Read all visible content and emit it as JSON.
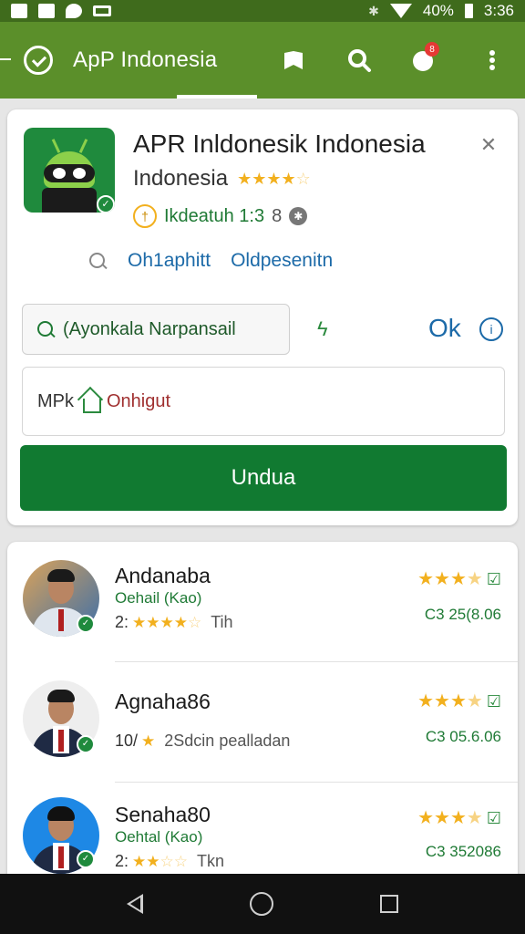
{
  "status_bar": {
    "battery": "40%",
    "time": "3:36"
  },
  "app_bar": {
    "title": "ApP Indonesia",
    "notification_count": "8"
  },
  "app_card": {
    "title": "APR Inldonesik Indonesia",
    "subtitle": "Indonesia",
    "rating_stars": "★★★★",
    "rating_outline": "☆",
    "meta_label": "Ikdeatuh 1:3",
    "meta_num": "8",
    "links": [
      "Oh1aphitt",
      "Oldpesenitn"
    ],
    "search_placeholder": "(Ayonkala Narpansail",
    "ok_label": "Ok",
    "option_label": "MPk",
    "option_value": "Onhigut",
    "download_label": "Undua"
  },
  "list": [
    {
      "name": "Andanaba",
      "sub": "Oehail (Kao)",
      "meta_prefix": "2:",
      "stars": "★★★★",
      "stars_outline": "☆",
      "meta_text": "Tih",
      "rating": "★★★",
      "rating_outline": "★",
      "code": "C3 25(8.06"
    },
    {
      "name": "Agnaha86",
      "sub": "",
      "meta_prefix": "10/",
      "stars": "★",
      "stars_outline": "",
      "meta_text": "2Sdcin pealladan",
      "rating": "★★★",
      "rating_outline": "★",
      "code": "C3 05.6.06"
    },
    {
      "name": "Senaha80",
      "sub": "Oehtal (Kao)",
      "meta_prefix": "2:",
      "stars": "★★",
      "stars_outline": "☆☆",
      "meta_text": "Tkn",
      "rating": "★★★",
      "rating_outline": "★",
      "code": "C3 352086"
    }
  ],
  "colors": {
    "app_bar": "#5b8f2a",
    "status_bar": "#3f6b1c",
    "primary_button": "#117a31",
    "link": "#1c6aa8",
    "star": "#f2b01e"
  }
}
